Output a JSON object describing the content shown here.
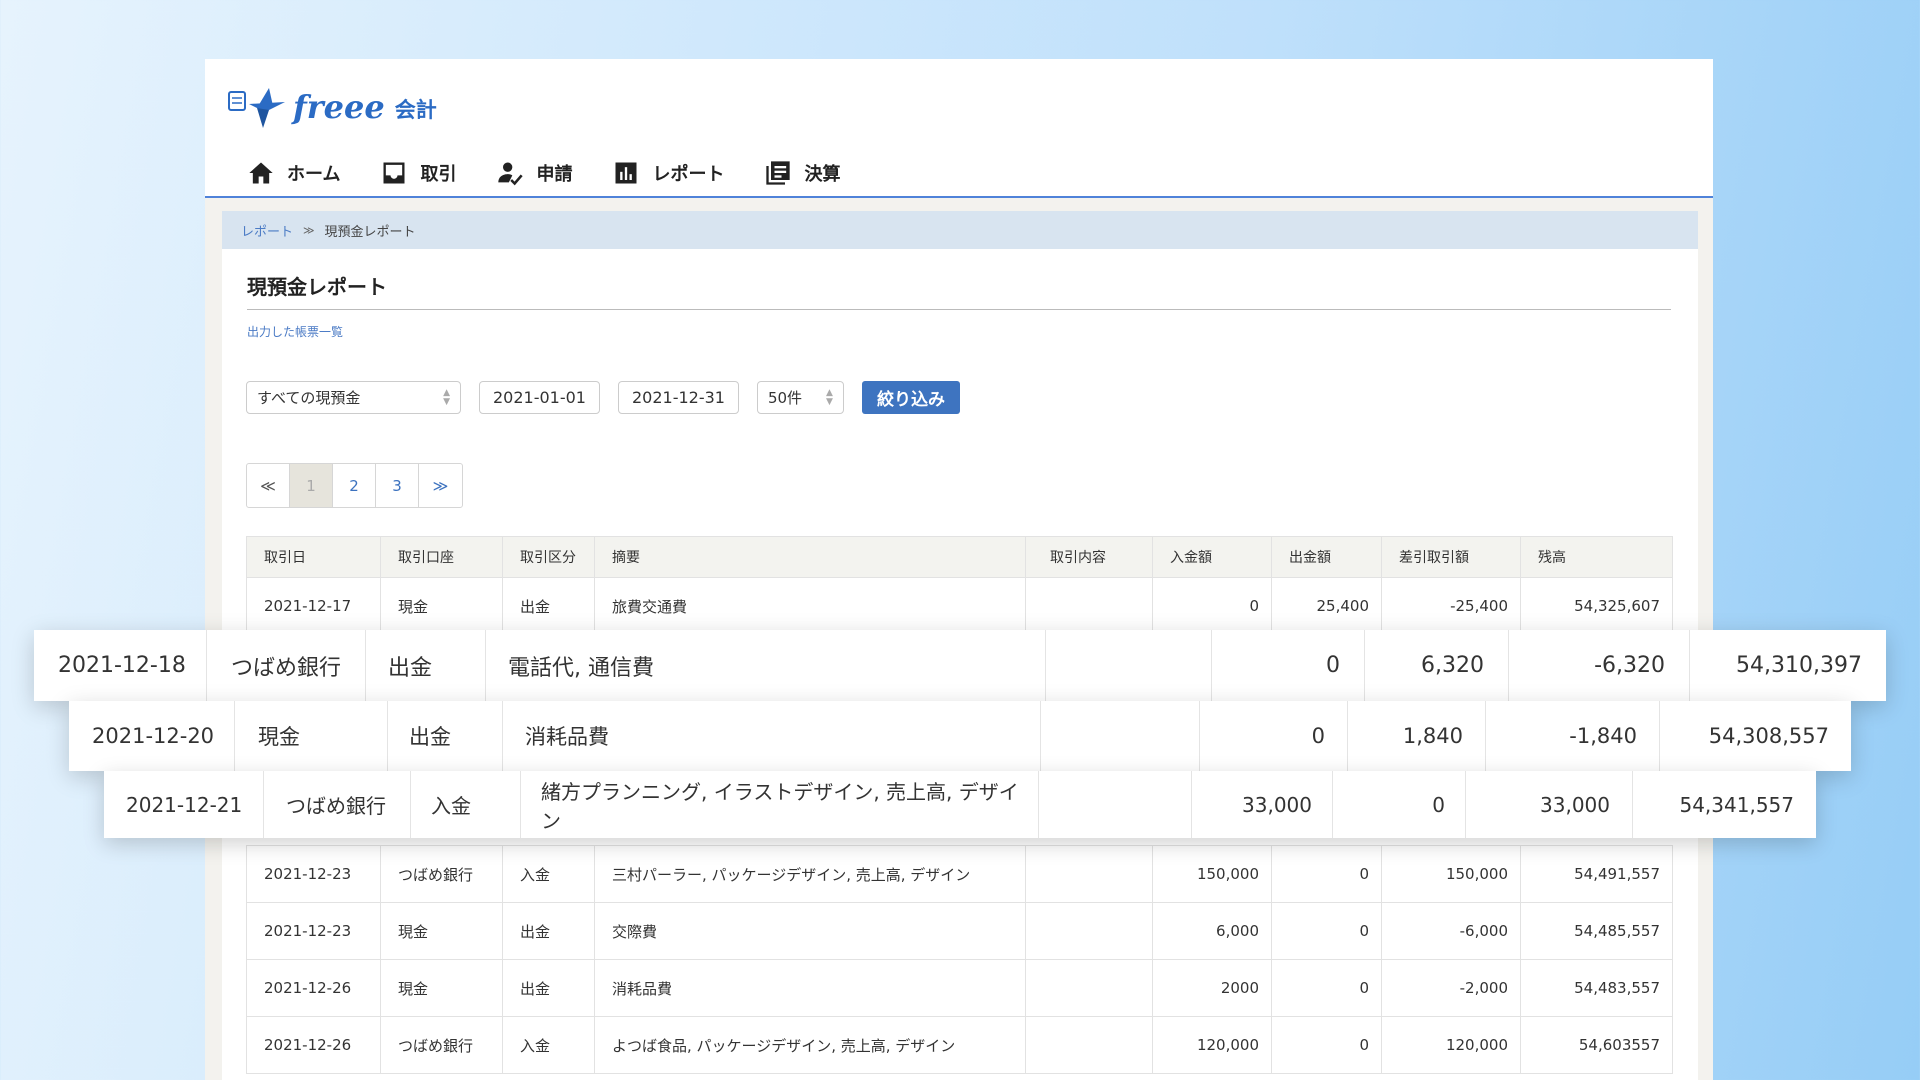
{
  "app": {
    "brand": "freee",
    "suffix": "会計"
  },
  "nav": [
    {
      "label": "ホーム",
      "icon": "home-icon",
      "active": false
    },
    {
      "label": "取引",
      "icon": "inbox-icon",
      "active": false
    },
    {
      "label": "申請",
      "icon": "user-check-icon",
      "active": false
    },
    {
      "label": "レポート",
      "icon": "bar-chart-icon",
      "active": true
    },
    {
      "label": "決算",
      "icon": "ledger-icon",
      "active": false
    }
  ],
  "breadcrumb": {
    "parent": "レポート",
    "separator": "≫",
    "current": "現預金レポート"
  },
  "page": {
    "title": "現預金レポート",
    "reports_link": "出力した帳票一覧"
  },
  "filters": {
    "account": "すべての現預金",
    "start_date": "2021-01-01",
    "end_date": "2021-12-31",
    "per_page": "50件",
    "submit": "絞り込み"
  },
  "pager": {
    "first": "≪",
    "pages": [
      "1",
      "2",
      "3"
    ],
    "current": "1",
    "last": "≫"
  },
  "table": {
    "headers": [
      "取引日",
      "取引口座",
      "取引区分",
      "摘要",
      "取引内容",
      "入金額",
      "出金額",
      "差引取引額",
      "残高"
    ],
    "rows": [
      {
        "date": "2021-12-17",
        "account": "現金",
        "type": "出金",
        "memo": "旅費交通費",
        "detail": "",
        "in": "0",
        "out": "25,400",
        "diff": "-25,400",
        "balance": "54,325,607"
      },
      {
        "date": "2021-12-23",
        "account": "つばめ銀行",
        "type": "入金",
        "memo": "三村パーラー, パッケージデザイン, 売上高, デザイン",
        "detail": "",
        "in": "150,000",
        "out": "0",
        "diff": "150,000",
        "balance": "54,491,557"
      },
      {
        "date": "2021-12-23",
        "account": "現金",
        "type": "出金",
        "memo": "交際費",
        "detail": "",
        "in": "6,000",
        "out": "0",
        "diff": "-6,000",
        "balance": "54,485,557"
      },
      {
        "date": "2021-12-26",
        "account": "現金",
        "type": "出金",
        "memo": "消耗品費",
        "detail": "",
        "in": "2000",
        "out": "0",
        "diff": "-2,000",
        "balance": "54,483,557"
      },
      {
        "date": "2021-12-26",
        "account": "つばめ銀行",
        "type": "入金",
        "memo": "よつば食品, パッケージデザイン, 売上高, デザイン",
        "detail": "",
        "in": "120,000",
        "out": "0",
        "diff": "120,000",
        "balance": "54,603557"
      }
    ],
    "highlighted_rows": [
      {
        "date": "2021-12-18",
        "account": "つばめ銀行",
        "type": "出金",
        "memo": "電話代, 通信費",
        "detail": "",
        "in": "0",
        "out": "6,320",
        "diff": "-6,320",
        "balance": "54,310,397"
      },
      {
        "date": "2021-12-20",
        "account": "現金",
        "type": "出金",
        "memo": "消耗品費",
        "detail": "",
        "in": "0",
        "out": "1,840",
        "diff": "-1,840",
        "balance": "54,308,557"
      },
      {
        "date": "2021-12-21",
        "account": "つばめ銀行",
        "type": "入金",
        "memo": "緒方プランニング, イラストデザイン, 売上高, デザイン",
        "detail": "",
        "in": "33,000",
        "out": "0",
        "diff": "33,000",
        "balance": "54,341,557"
      }
    ]
  },
  "colors": {
    "accent": "#2f6bd2",
    "button": "#3e74c0",
    "link": "#4b7bc5",
    "breadcrumb_bg": "#d8e4f0"
  }
}
